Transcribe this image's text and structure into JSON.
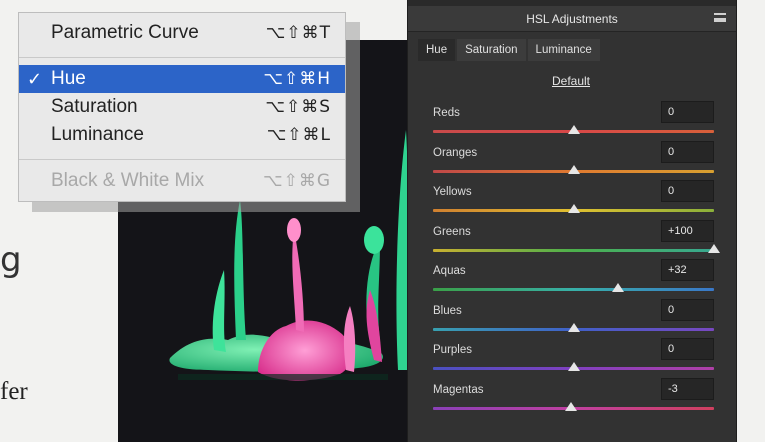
{
  "background": {
    "text_fragment_1": "g",
    "text_fragment_2": "fer"
  },
  "menu": {
    "items": [
      {
        "label": "Parametric Curve",
        "shortcut": "⌥⇧⌘T",
        "state": "normal"
      },
      {
        "label": "Hue",
        "shortcut": "⌥⇧⌘H",
        "state": "selected",
        "check": "✓"
      },
      {
        "label": "Saturation",
        "shortcut": "⌥⇧⌘S",
        "state": "normal"
      },
      {
        "label": "Luminance",
        "shortcut": "⌥⇧⌘L",
        "state": "normal"
      },
      {
        "label": "Black & White Mix",
        "shortcut": "⌥⇧⌘G",
        "state": "disabled"
      }
    ],
    "colors": {
      "selected": "#2c64c8"
    }
  },
  "panel": {
    "title": "HSL Adjustments",
    "tabs": [
      {
        "label": "Hue",
        "active": true
      },
      {
        "label": "Saturation",
        "active": false
      },
      {
        "label": "Luminance",
        "active": false
      }
    ],
    "default_label": "Default",
    "rows": [
      {
        "label": "Reds",
        "value": "0",
        "position": 0.5
      },
      {
        "label": "Oranges",
        "value": "0",
        "position": 0.5
      },
      {
        "label": "Yellows",
        "value": "0",
        "position": 0.5
      },
      {
        "label": "Greens",
        "value": "+100",
        "position": 1.0
      },
      {
        "label": "Aquas",
        "value": "+32",
        "position": 0.66
      },
      {
        "label": "Blues",
        "value": "0",
        "position": 0.5
      },
      {
        "label": "Purples",
        "value": "0",
        "position": 0.5
      },
      {
        "label": "Magentas",
        "value": "-3",
        "position": 0.49
      }
    ]
  }
}
